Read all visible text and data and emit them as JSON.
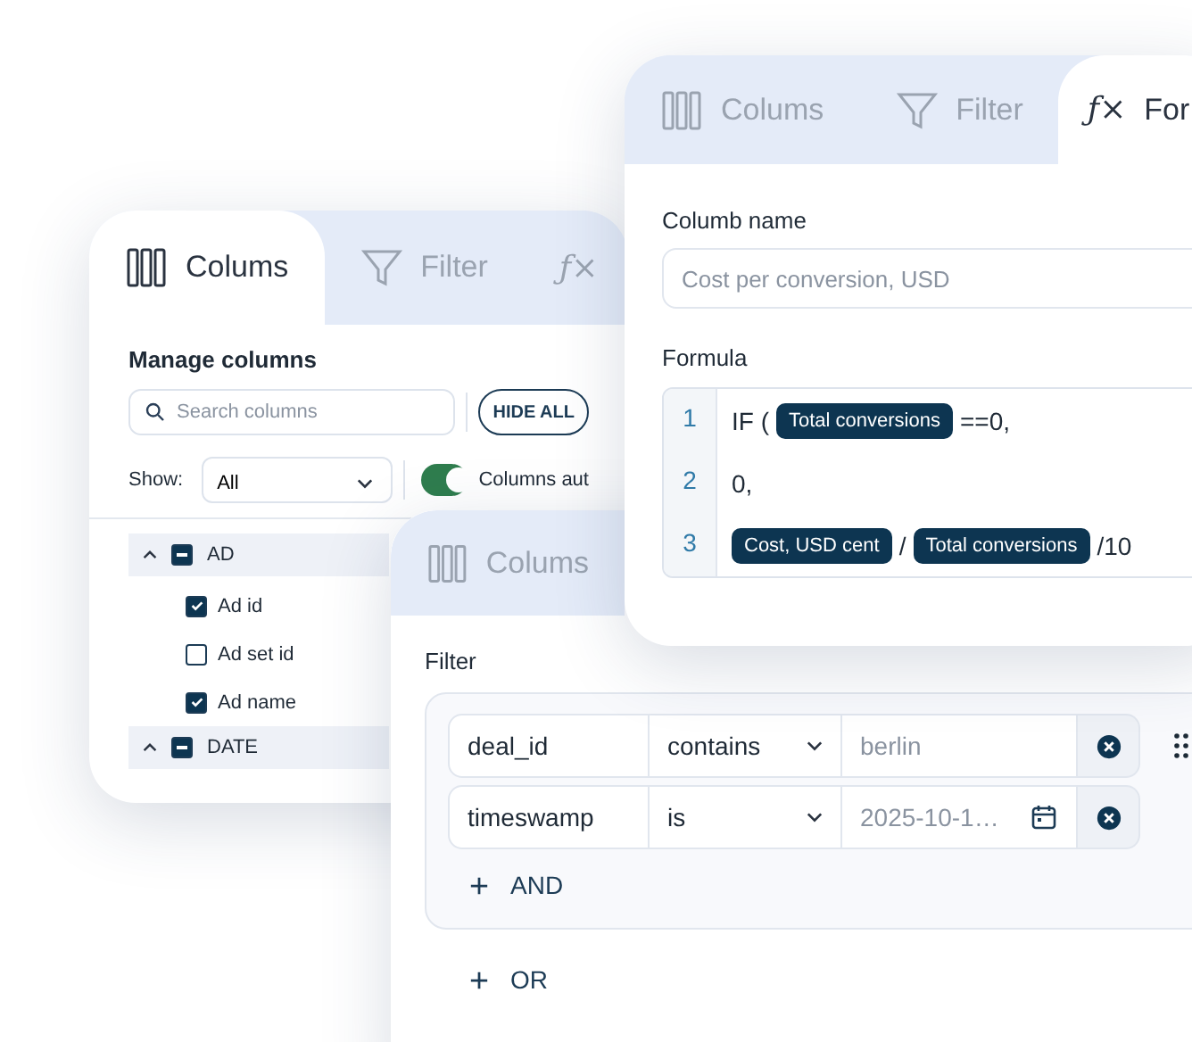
{
  "columns_panel": {
    "tabs": [
      {
        "kind": "columns",
        "label": "Colums",
        "selected": true
      },
      {
        "kind": "filter",
        "label": "Filter",
        "selected": false
      },
      {
        "kind": "formula",
        "symbol": "ƒ×",
        "selected": false
      }
    ],
    "title": "Manage columns",
    "search": {
      "placeholder": "Search columns"
    },
    "hide_all_button": "HIDE ALL",
    "show_label": "Show:",
    "show_select": {
      "value": "All"
    },
    "auto_toggle": {
      "on": true,
      "label": "Columns aut"
    },
    "groups": [
      {
        "name": "AD",
        "expanded": true,
        "indeterminate": true,
        "items": [
          {
            "label": "Ad id",
            "checked": true
          },
          {
            "label": "Ad set id",
            "checked": false
          },
          {
            "label": "Ad name",
            "checked": true
          }
        ]
      },
      {
        "name": "DATE",
        "expanded": true,
        "indeterminate": true
      }
    ]
  },
  "formula_panel": {
    "tabs": [
      {
        "kind": "columns",
        "label": "Colums",
        "selected": false
      },
      {
        "kind": "filter",
        "label": "Filter",
        "selected": false
      },
      {
        "kind": "formula",
        "symbol": "ƒ×",
        "label": "For",
        "selected": true
      }
    ],
    "name_label": "Columb name",
    "name_field": {
      "placeholder": "Cost per conversion, USD"
    },
    "formula_label": "Formula",
    "lines": [
      {
        "number": "1",
        "tokens": [
          {
            "kind": "text",
            "text": "IF ("
          },
          {
            "kind": "chip",
            "text": "Total conversions"
          },
          {
            "kind": "text",
            "text": "==0,"
          }
        ]
      },
      {
        "number": "2",
        "tokens": [
          {
            "kind": "text",
            "text": "0,"
          }
        ]
      },
      {
        "number": "3",
        "tokens": [
          {
            "kind": "chip",
            "text": "Cost, USD cent"
          },
          {
            "kind": "text",
            "text": "/"
          },
          {
            "kind": "chip",
            "text": "Total conversions"
          },
          {
            "kind": "text",
            "text": "/10"
          }
        ]
      }
    ]
  },
  "filter_panel": {
    "tabs": [
      {
        "kind": "columns",
        "label": "Colums",
        "selected": false
      }
    ],
    "title": "Filter",
    "rows": [
      {
        "field": "deal_id",
        "operator": "contains",
        "value": {
          "kind": "text",
          "placeholder": "berlin"
        }
      },
      {
        "field": "timeswamp",
        "operator": "is",
        "value": {
          "kind": "date",
          "placeholder": "2025-10-1…"
        }
      }
    ],
    "and_button": "AND",
    "or_button": "OR"
  }
}
